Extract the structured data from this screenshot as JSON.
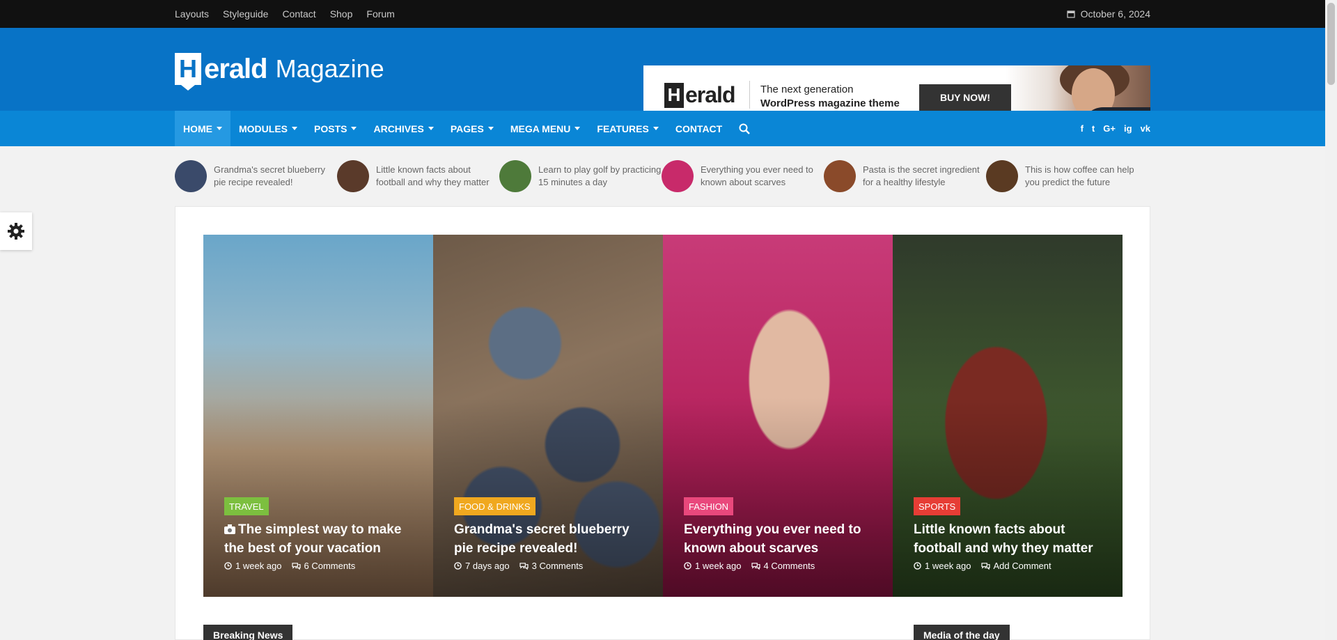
{
  "topbar": {
    "links": [
      "Layouts",
      "Styleguide",
      "Contact",
      "Shop",
      "Forum"
    ],
    "date": "October 6, 2024"
  },
  "logo": {
    "mark": "H",
    "word_a": "erald",
    "word_b": "Magazine"
  },
  "ad": {
    "logo_mark": "H",
    "logo_word": "erald",
    "line1": "The next generation",
    "line2": "WordPress magazine theme",
    "button": "BUY NOW!"
  },
  "nav": {
    "items": [
      {
        "label": "HOME",
        "dropdown": true,
        "active": true
      },
      {
        "label": "MODULES",
        "dropdown": true
      },
      {
        "label": "POSTS",
        "dropdown": true
      },
      {
        "label": "ARCHIVES",
        "dropdown": true
      },
      {
        "label": "PAGES",
        "dropdown": true
      },
      {
        "label": "MEGA MENU",
        "dropdown": true
      },
      {
        "label": "FEATURES",
        "dropdown": true
      },
      {
        "label": "CONTACT",
        "dropdown": false
      }
    ],
    "social": [
      "f",
      "t",
      "G+",
      "ig",
      "vk"
    ]
  },
  "ticker": [
    {
      "text": "Grandma's secret blueberry pie recipe revealed!",
      "color": "#3a4a6a"
    },
    {
      "text": "Little known facts about football and why they matter",
      "color": "#5a3a2a"
    },
    {
      "text": "Learn to play golf by practicing 15 minutes a day",
      "color": "#4e7a3a"
    },
    {
      "text": "Everything you ever need to known about scarves",
      "color": "#c82a6a"
    },
    {
      "text": "Pasta is the secret ingredient for a healthy lifestyle",
      "color": "#8a4a2a"
    },
    {
      "text": "This is how coffee can help you predict the future",
      "color": "#5a3a22"
    }
  ],
  "featured": [
    {
      "category": "TRAVEL",
      "badge_color": "#7cbf3f",
      "title": "The simplest way to make the best of your vacation",
      "has_camera": true,
      "time": "1 week ago",
      "comments": "6 Comments"
    },
    {
      "category": "FOOD & DRINKS",
      "badge_color": "#f0a81f",
      "title": "Grandma's secret blueberry pie recipe revealed!",
      "has_camera": false,
      "time": "7 days ago",
      "comments": "3 Comments"
    },
    {
      "category": "FASHION",
      "badge_color": "#e9487c",
      "title": "Everything you ever need to known about scarves",
      "has_camera": false,
      "time": "1 week ago",
      "comments": "4 Comments"
    },
    {
      "category": "SPORTS",
      "badge_color": "#e63d35",
      "title": "Little known facts about football and why they matter",
      "has_camera": false,
      "time": "1 week ago",
      "comments": "Add Comment"
    }
  ],
  "sections": {
    "breaking_news": "Breaking News",
    "media_of_day": "Media of the day"
  }
}
